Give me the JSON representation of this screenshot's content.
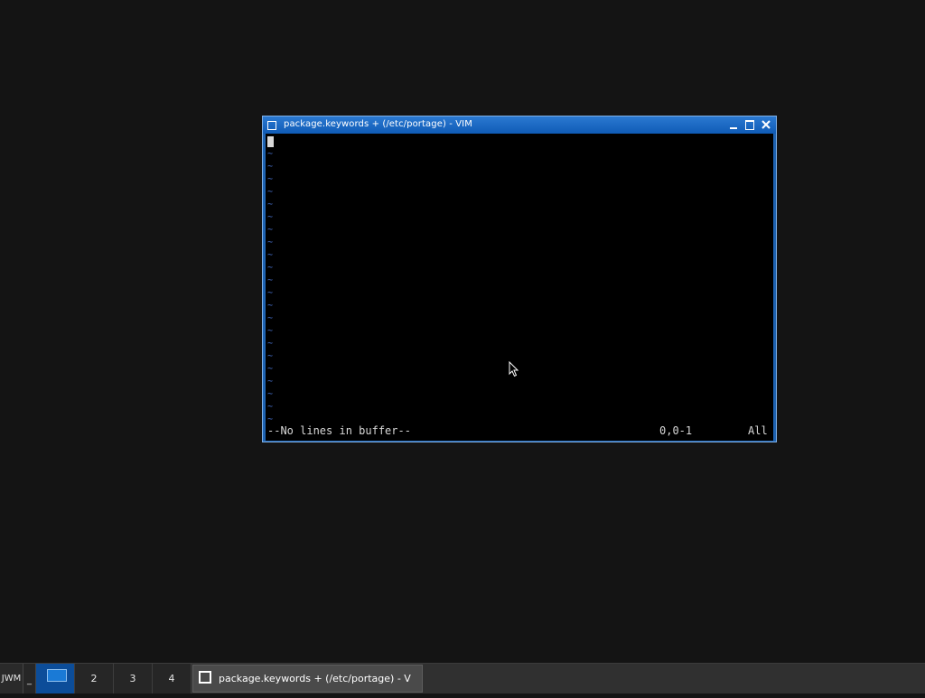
{
  "window": {
    "title": "package.keywords + (/etc/portage) - VIM",
    "icon": "window-icon",
    "controls": {
      "minimize_icon": "minimize-icon",
      "maximize_icon": "maximize-icon",
      "close_icon": "close-icon"
    }
  },
  "editor": {
    "empty_line_markers": [
      "~",
      "~",
      "~",
      "~",
      "~",
      "~",
      "~",
      "~",
      "~",
      "~",
      "~",
      "~",
      "~",
      "~",
      "~",
      "~",
      "~",
      "~",
      "~",
      "~",
      "~",
      "~"
    ],
    "status_message": "--No lines in buffer--",
    "cursor_position": "0,0-1",
    "scroll_position": "All"
  },
  "taskbar": {
    "menu_label": "JWM",
    "show_desktop_label": "_",
    "desktops": [
      {
        "label": "",
        "active": true
      },
      {
        "label": "2",
        "active": false
      },
      {
        "label": "3",
        "active": false
      },
      {
        "label": "4",
        "active": false
      }
    ],
    "tasks": [
      {
        "label": "package.keywords + (/etc/portage) - V",
        "icon": "window-icon"
      }
    ]
  },
  "colors": {
    "desktop_background": "#141414",
    "titlebar": "#1a6ac6",
    "terminal_background": "#000000",
    "tilde": "#4a74d4",
    "taskbar": "#303030",
    "active_desktop": "#0c4d99"
  }
}
